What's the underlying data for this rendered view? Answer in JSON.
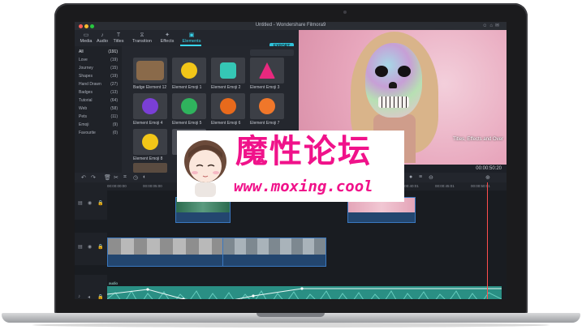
{
  "window": {
    "title": "Untitled - Wondershare Filmora9"
  },
  "tabs": [
    {
      "label": "Media",
      "icon": "folder-icon"
    },
    {
      "label": "Audio",
      "icon": "music-note-icon"
    },
    {
      "label": "Titles",
      "icon": "text-icon"
    },
    {
      "label": "Transition",
      "icon": "transition-icon"
    },
    {
      "label": "Effects",
      "icon": "effects-icon"
    },
    {
      "label": "Elements",
      "icon": "elements-icon",
      "active": true
    }
  ],
  "export_label": "EXPORT",
  "categories": [
    {
      "label": "All",
      "count": "(191)"
    },
    {
      "label": "Love",
      "count": "(19)"
    },
    {
      "label": "Journey",
      "count": "(15)"
    },
    {
      "label": "Shapes",
      "count": "(19)"
    },
    {
      "label": "Hand Drawn",
      "count": "(27)"
    },
    {
      "label": "Badges",
      "count": "(13)"
    },
    {
      "label": "Tutorial",
      "count": "(64)"
    },
    {
      "label": "Web",
      "count": "(58)"
    },
    {
      "label": "Pets",
      "count": "(11)"
    },
    {
      "label": "Emoji",
      "count": "(9)"
    },
    {
      "label": "Favourite",
      "count": "(0)"
    }
  ],
  "elements": [
    {
      "label": "Badge Element 12",
      "color": "#8a6a4a"
    },
    {
      "label": "Element Emoji 1",
      "color": "#f2c618"
    },
    {
      "label": "Element Emoji 2",
      "color": "#35c7b5"
    },
    {
      "label": "Element Emoji 3",
      "color": "#e8287e"
    },
    {
      "label": "Element Emoji 4",
      "color": "#7a3fd6"
    },
    {
      "label": "Element Emoji 5",
      "color": "#2fb35d"
    },
    {
      "label": "Element Emoji 6",
      "color": "#e86a1c"
    },
    {
      "label": "Element Emoji 7",
      "color": "#f0772a"
    },
    {
      "label": "Element Emoji 8",
      "color": "#f2c618"
    }
  ],
  "preview": {
    "caption": "Titles, Effects and Over",
    "timecode": "00:00:50:20"
  },
  "ruler": [
    "00:00:00:00",
    "00:00:05:00",
    "00:00:10:00",
    "00:00:15:00",
    "00:00:40:01",
    "00:00:45:01",
    "00:00:50:01"
  ],
  "audio": {
    "label": "audio"
  },
  "watermark": {
    "title": "魔性论坛",
    "url": "www.moxing.cool"
  },
  "colors": {
    "accent": "#38d6ee",
    "playhead": "#ff4d4d",
    "watermark": "#f0128a"
  }
}
